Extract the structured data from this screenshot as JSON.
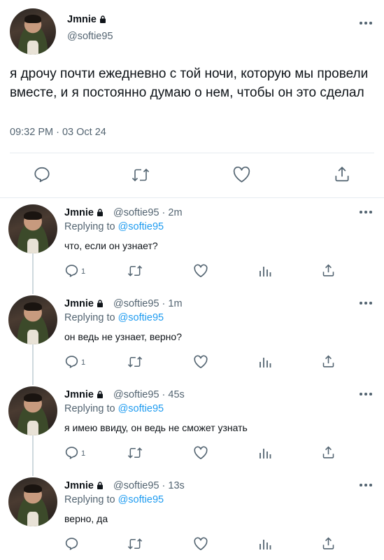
{
  "main_tweet": {
    "display_name": "Jmnie",
    "handle": "@softie95",
    "text": "я дрочу почти ежедневно с той ночи, которую мы провели вместе, и я постоянно думаю о нем, чтобы он это сделал",
    "timestamp": "09:32 PM · 03 Oct 24"
  },
  "replies": [
    {
      "display_name": "Jmnie",
      "handle_time": "@softie95 · 2m",
      "replying_prefix": "Replying to",
      "replying_to": "@softie95",
      "text": "что, если он узнает?",
      "reply_count": "1"
    },
    {
      "display_name": "Jmnie",
      "handle_time": "@softie95 · 1m",
      "replying_prefix": "Replying to",
      "replying_to": "@softie95",
      "text": "он ведь не узнает, верно?",
      "reply_count": "1"
    },
    {
      "display_name": "Jmnie",
      "handle_time": "@softie95 · 45s",
      "replying_prefix": "Replying to",
      "replying_to": "@softie95",
      "text": "я имею ввиду, он ведь не сможет узнать",
      "reply_count": "1"
    },
    {
      "display_name": "Jmnie",
      "handle_time": "@softie95 · 13s",
      "replying_prefix": "Replying to",
      "replying_to": "@softie95",
      "text": "верно, да",
      "reply_count": ""
    }
  ],
  "icons": {
    "reply": "reply-icon",
    "retweet": "retweet-icon",
    "like": "heart-icon",
    "share": "share-icon",
    "views": "views-icon",
    "more": "more-icon",
    "lock": "lock-icon"
  },
  "colors": {
    "text": "#0f1419",
    "secondary": "#536471",
    "link": "#1d9bf0",
    "divider": "#e6ecf0"
  }
}
